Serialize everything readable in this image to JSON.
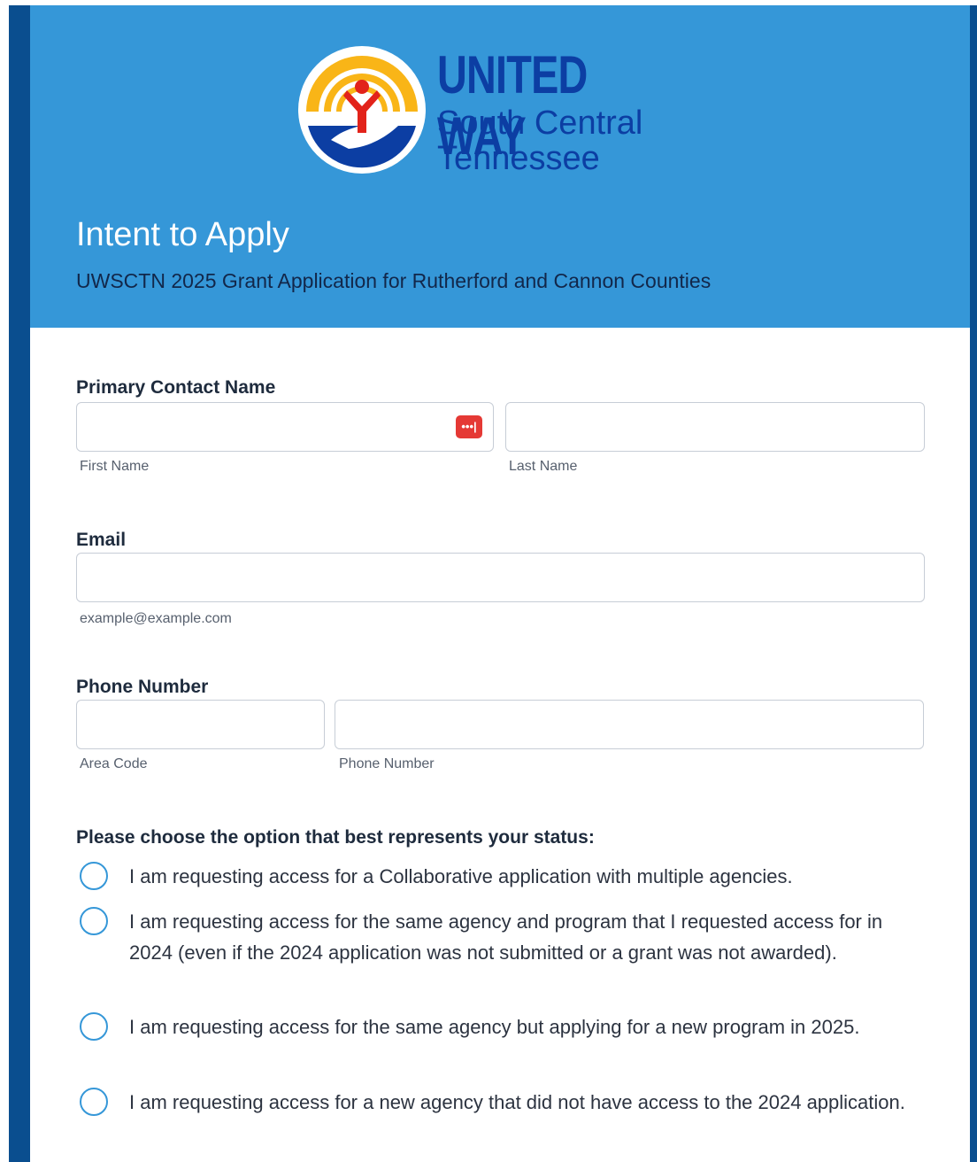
{
  "logo": {
    "line1": "UNITED WAY",
    "line2": "South Central",
    "line3": "Tennessee"
  },
  "header": {
    "title": "Intent to Apply",
    "subtitle": "UWSCTN 2025 Grant Application for Rutherford and Cannon Counties",
    "background": "#3597d8"
  },
  "fields": {
    "contact": {
      "label": "Primary Contact Name",
      "first_sub": "First Name",
      "last_sub": "Last Name",
      "first_value": "",
      "last_value": "",
      "password_manager_icon": "•••|"
    },
    "email": {
      "label": "Email",
      "value": "",
      "sub": "example@example.com"
    },
    "phone": {
      "label": "Phone Number",
      "area_sub": "Area Code",
      "number_sub": "Phone Number",
      "area_value": "",
      "number_value": ""
    }
  },
  "status": {
    "question": "Please choose the option that best represents your status:",
    "options": [
      "I am requesting access for a Collaborative application with multiple agencies.",
      "I am requesting access for the same agency and program that I requested access for in 2024 (even if the 2024 application was not submitted or a grant was not awarded).",
      "I am requesting access for the same agency but applying for a new program in 2025.",
      "I am requesting access for a new agency that did not have access to the 2024 application."
    ]
  },
  "colors": {
    "accent": "#3597d8",
    "brand_dark": "#0a4e8f",
    "logo_blue": "#0c3ea3",
    "logo_yellow": "#f9b517",
    "logo_red": "#e2231a"
  }
}
